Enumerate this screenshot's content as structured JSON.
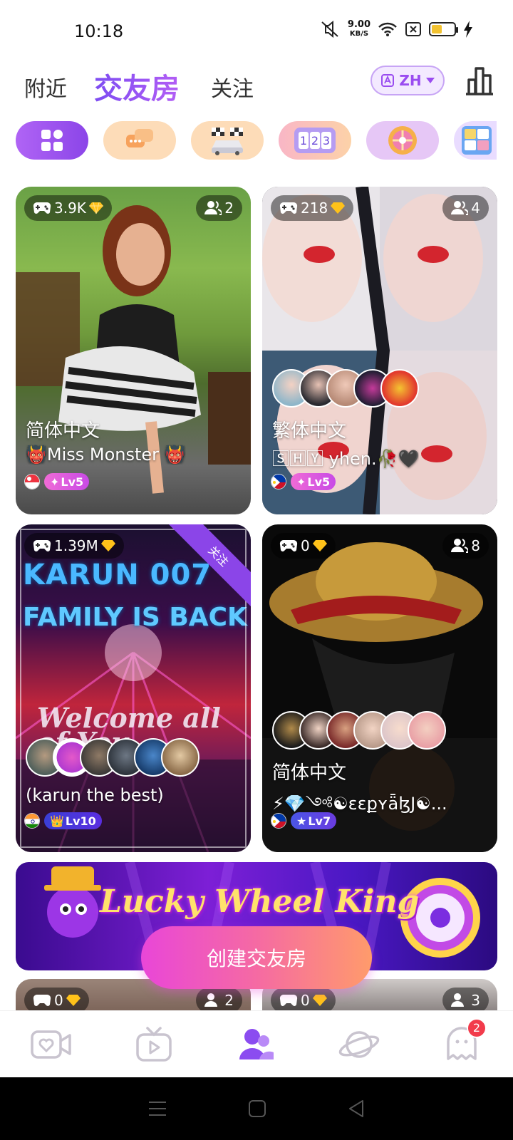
{
  "status": {
    "time": "10:18",
    "speed_value": "9.00",
    "speed_unit": "KB/S"
  },
  "header": {
    "tabs": [
      {
        "label": "附近"
      },
      {
        "label": "交友房"
      },
      {
        "label": "关注"
      }
    ],
    "active_tab": "交友房",
    "language_label": "ZH"
  },
  "categories": [
    {
      "icon": "grid-icon",
      "color": "#a855f7"
    },
    {
      "icon": "chat-icon",
      "color": "#fbd8b0"
    },
    {
      "icon": "race-icon",
      "color": "#fbd8b0"
    },
    {
      "icon": "number-game-icon",
      "color": "#f3b9c4"
    },
    {
      "icon": "wheel-icon",
      "color": "#e7c6f5"
    },
    {
      "icon": "sudoku-icon",
      "color": "#e9d6ff"
    }
  ],
  "rooms": [
    {
      "gems": "3.9K",
      "members": "2",
      "language": "简体中文",
      "title": "👹Miss Monster 👹",
      "level": "Lv5",
      "flag": "singapore-flag"
    },
    {
      "gems": "218",
      "members": "4",
      "language": "繁体中文",
      "title": "🅂🄷🅈 yhen.🥀🖤",
      "level": "Lv5",
      "flag": "philippines-flag"
    },
    {
      "gems": "1.39M",
      "members": "",
      "language": "",
      "title": "(karun the best)",
      "level": "Lv10",
      "flag": "india-flag",
      "ribbon": "关注",
      "poster_line1": "KARUN 007",
      "poster_line2": "FAMILY IS BACK",
      "poster_line3": "Welcome all of You"
    },
    {
      "gems": "0",
      "members": "8",
      "language": "简体中文",
      "title": "⚡💎༺☯ɛɛքʏǟɮJ☯...",
      "level": "Lv7",
      "flag": "philippines-flag"
    },
    {
      "gems": "0",
      "members": "2"
    },
    {
      "gems": "0",
      "members": "3"
    }
  ],
  "banner": {
    "title": "Lucky Wheel King"
  },
  "create_button": "创建交友房",
  "nav": {
    "badge_count": "2"
  }
}
